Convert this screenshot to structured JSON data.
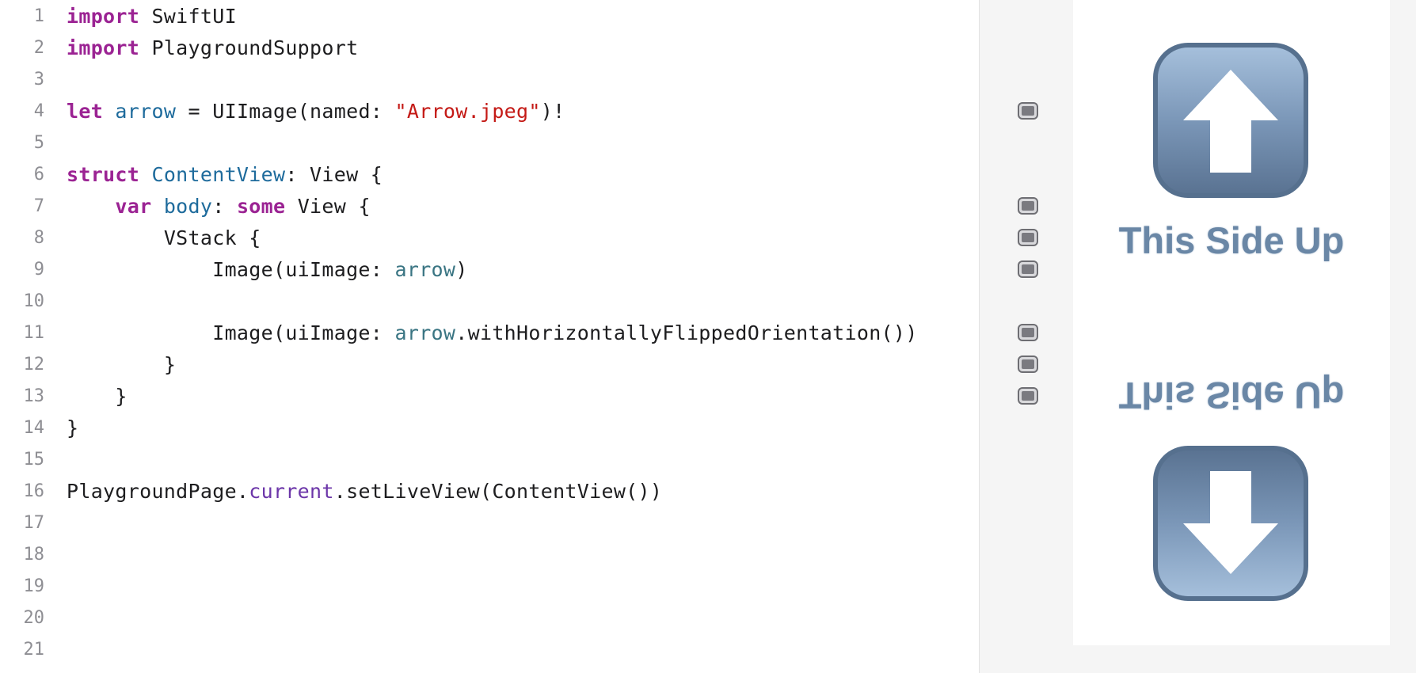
{
  "editor": {
    "line_numbers": [
      "1",
      "2",
      "3",
      "4",
      "5",
      "6",
      "7",
      "8",
      "9",
      "10",
      "11",
      "12",
      "13",
      "14",
      "15",
      "16",
      "17",
      "18",
      "19",
      "20",
      "21"
    ],
    "code": {
      "l1_kw": "import",
      "l1_rest": " SwiftUI",
      "l2_kw": "import",
      "l2_rest": " PlaygroundSupport",
      "l4_kw": "let",
      "l4_var": "arrow",
      "l4_mid": " = UIImage(named: ",
      "l4_str": "\"Arrow.jpeg\"",
      "l4_end": ")!",
      "l6_kw": "struct",
      "l6_type": "ContentView",
      "l6_rest": ": View {",
      "l7_kw1": "var",
      "l7_var": "body",
      "l7_mid": ": ",
      "l7_kw2": "some",
      "l7_rest": " View {",
      "l8": "VStack {",
      "l9_a": "Image(uiImage: ",
      "l9_var": "arrow",
      "l9_b": ")",
      "l11_a": "Image(uiImage: ",
      "l11_var": "arrow",
      "l11_b": ".withHorizontallyFlippedOrientation())",
      "l12": "}",
      "l13": "}",
      "l14": "}",
      "l16_a": "PlaygroundPage.",
      "l16_prop": "current",
      "l16_b": ".setLiveView(ContentView())"
    }
  },
  "live_view": {
    "top_label": "This Side Up",
    "bottom_label": "This Side Up",
    "top_icon": "arrow-up-icon",
    "bottom_icon": "arrow-down-icon"
  },
  "colors": {
    "keyword": "#9b2393",
    "type": "#1e6b9c",
    "string": "#c41a16",
    "member": "#3a7583",
    "arrow_icon": "#6a87a6"
  }
}
